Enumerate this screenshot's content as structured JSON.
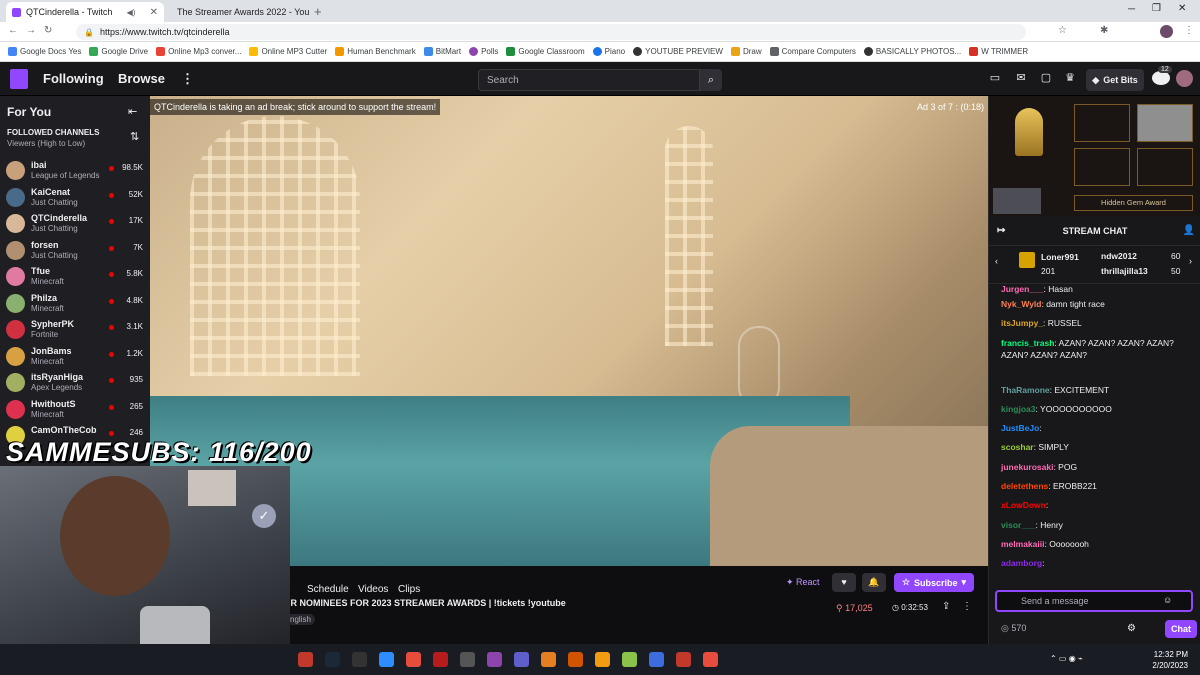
{
  "browser": {
    "tabs": [
      {
        "title": "QTCinderella - Twitch",
        "active": true
      },
      {
        "title": "The Streamer Awards 2022 - You",
        "active": false
      }
    ],
    "url": "https://www.twitch.tv/qtcinderella",
    "bookmarks": [
      "Google Docs Yes",
      "Google Drive",
      "Online Mp3 conver...",
      "Online MP3 Cutter",
      "Human Benchmark",
      "BitMart",
      "Polls",
      "Google Classroom",
      "Piano",
      "YOUTUBE PREVIEW",
      "Draw",
      "Compare Computers",
      "BASICALLY PHOTOS...",
      "W TRIMMER"
    ]
  },
  "nav": {
    "following": "Following",
    "browse": "Browse",
    "search_placeholder": "Search",
    "get_bits": "Get Bits",
    "notif_count": "12"
  },
  "sidebar": {
    "title": "For You",
    "section": "FOLLOWED CHANNELS",
    "sort": "Viewers (High to Low)",
    "channels": [
      {
        "name": "ibai",
        "game": "League of Legends",
        "viewers": "98.5K",
        "color": "#c8a07a"
      },
      {
        "name": "KaiCenat",
        "game": "Just Chatting",
        "viewers": "52K",
        "color": "#4a6a8a"
      },
      {
        "name": "QTCinderella",
        "game": "Just Chatting",
        "viewers": "17K",
        "color": "#d9b89a"
      },
      {
        "name": "forsen",
        "game": "Just Chatting",
        "viewers": "7K",
        "color": "#b09070"
      },
      {
        "name": "Tfue",
        "game": "Minecraft",
        "viewers": "5.8K",
        "color": "#e07aa0"
      },
      {
        "name": "Philza",
        "game": "Minecraft",
        "viewers": "4.8K",
        "color": "#8ab070"
      },
      {
        "name": "SypherPK",
        "game": "Fortnite",
        "viewers": "3.1K",
        "color": "#d03040"
      },
      {
        "name": "JonBams",
        "game": "Minecraft",
        "viewers": "1.2K",
        "color": "#d8a040"
      },
      {
        "name": "itsRyanHiga",
        "game": "Apex Legends",
        "viewers": "935",
        "color": "#a0b060"
      },
      {
        "name": "HwithoutS",
        "game": "Minecraft",
        "viewers": "265",
        "color": "#e03050"
      },
      {
        "name": "CamOnTheCob",
        "game": "",
        "viewers": "246",
        "color": "#e0d040"
      }
    ]
  },
  "player": {
    "ad_notice": "QTCinderella is taking an ad break; stick around to support the stream!",
    "ad_counter": "Ad 3 of 7 : (0:18)"
  },
  "overlay": {
    "subs": "SAMMESUBS: 116/200"
  },
  "info": {
    "tabs": [
      "Schedule",
      "Videos",
      "Clips"
    ],
    "title": "UR NOMINEES FOR 2023 STREAMER AWARDS | !tickets !youtube",
    "tag": "nglish",
    "react": "React",
    "subscribe": "Subscribe",
    "viewers": "17,025",
    "uptime": "0:32:53"
  },
  "right": {
    "award_label": "Hidden Gem Award",
    "chat_title": "STREAM CHAT",
    "leaders": [
      {
        "name": "Loner991",
        "value": "201"
      },
      {
        "name": "ndw2012",
        "value": "60"
      },
      {
        "name": "thrillajilla13",
        "value": "50"
      }
    ],
    "messages": [
      {
        "user": "Jurgen___",
        "text": ": Hasan",
        "color": "#ff69b4"
      },
      {
        "user": "Nyk_Wyld",
        "text": ": damn tight race",
        "color": "#ff7f50"
      },
      {
        "user": "itsJumpy_",
        "text": ": RUSSEL",
        "color": "#daa520"
      },
      {
        "user": "francis_trash",
        "text": ": AZAN? AZAN? AZAN? AZAN? AZAN? AZAN? AZAN?",
        "color": "#00ff7f"
      },
      {
        "user": "ThaRamone",
        "text": ": EXCITEMENT",
        "color": "#5f9ea0"
      },
      {
        "user": "kingjoa3",
        "text": ": YOOOOOOOOOO",
        "color": "#2e8b57"
      },
      {
        "user": "JustBeJo",
        "text": ":",
        "color": "#1e90ff"
      },
      {
        "user": "scoshar",
        "text": ": SIMPLY",
        "color": "#9acd32"
      },
      {
        "user": "junekurosaki",
        "text": ": POG",
        "color": "#ff69b4"
      },
      {
        "user": "deletethens",
        "text": ": EROBB221",
        "color": "#ff4500"
      },
      {
        "user": "xLowDown",
        "text": ":",
        "color": "#ff0000"
      },
      {
        "user": "visor___",
        "text": ": Henry",
        "color": "#2e8b57"
      },
      {
        "user": "melmakaiii",
        "text": ": Oooooooh",
        "color": "#ff69b4"
      },
      {
        "user": "adamborg",
        "text": ":",
        "color": "#8a2be2"
      }
    ],
    "input_placeholder": "Send a message",
    "points": "570",
    "chat_button": "Chat"
  },
  "taskbar": {
    "time": "12:32 PM",
    "date": "2/20/2023"
  }
}
